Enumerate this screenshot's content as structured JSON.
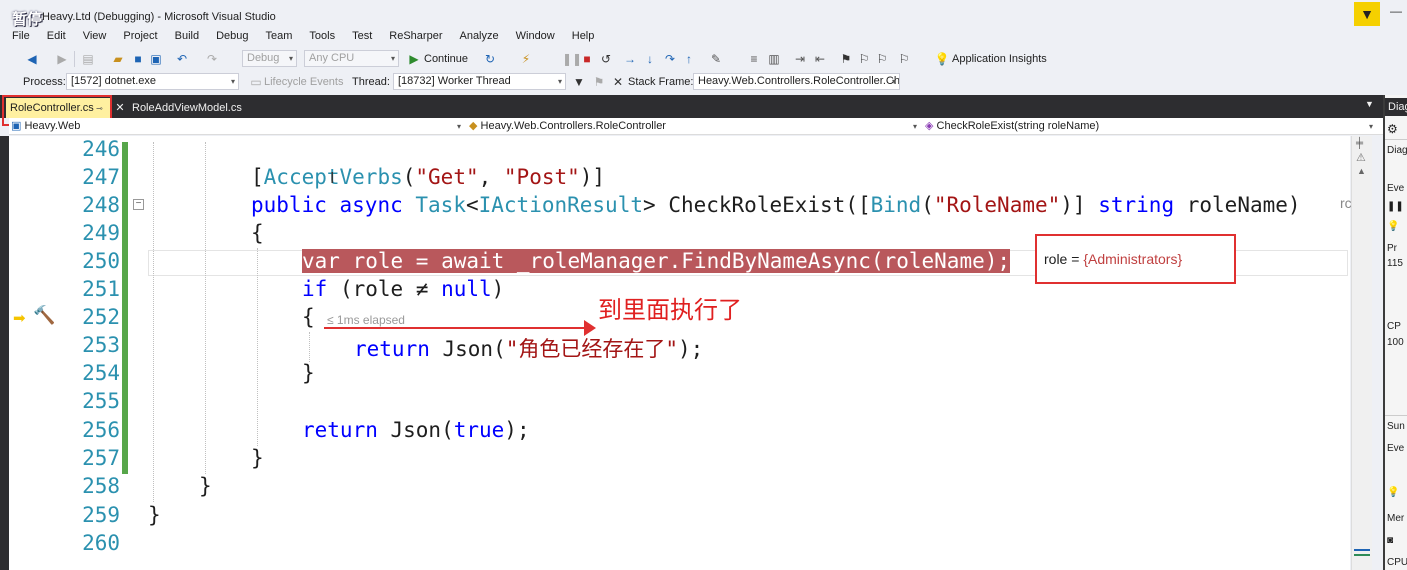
{
  "window": {
    "title": "Heavy.Ltd (Debugging) - Microsoft Visual Studio",
    "pause_badge": "暂停"
  },
  "menu": [
    "File",
    "Edit",
    "View",
    "Project",
    "Build",
    "Debug",
    "Team",
    "Tools",
    "Test",
    "ReSharper",
    "Analyze",
    "Window",
    "Help"
  ],
  "toolbar": {
    "config": "Debug",
    "platform": "Any CPU",
    "continue_label": "Continue",
    "app_insights_label": "Application Insights",
    "process_label": "Process:",
    "process_value": "[1572] dotnet.exe",
    "lifecycle_label": "Lifecycle Events",
    "thread_label": "Thread:",
    "thread_value": "[18732] Worker Thread",
    "stack_frame_label": "Stack Frame:",
    "stack_frame_value": "Heavy.Web.Controllers.RoleController.Che"
  },
  "tabs": {
    "active": "RoleController.cs",
    "inactive": "RoleAddViewModel.cs"
  },
  "navbar": {
    "project": "Heavy.Web",
    "class": "Heavy.Web.Controllers.RoleController",
    "member": "CheckRoleExist(string roleName)"
  },
  "editor": {
    "line_numbers": [
      "246",
      "247",
      "248",
      "249",
      "250",
      "251",
      "252",
      "253",
      "254",
      "255",
      "256",
      "257",
      "258",
      "259",
      "260"
    ],
    "elapsed": "≤ 1ms elapsed",
    "annotation": "到里面执行了",
    "datatip_name": "role = ",
    "datatip_value": "{Administrators}",
    "code": {
      "l247_a": "[",
      "l247_attr": "AcceptVerbs",
      "l247_b": "(",
      "l247_s1": "\"Get\"",
      "l247_c": ", ",
      "l247_s2": "\"Post\"",
      "l247_d": ")]",
      "l248_kw1": "public",
      "l248_kw2": "async",
      "l248_t1": "Task",
      "l248_lt": "<",
      "l248_t2": "IActionResult",
      "l248_gt": ">",
      "l248_name": "CheckRoleExist([",
      "l248_t3": "Bind",
      "l248_p": "(",
      "l248_s": "\"RoleName\"",
      "l248_q": ")]",
      "l248_kw3": "string",
      "l248_param": "roleName)",
      "l249": "{",
      "l250": "var role = await _roleManager.FindByNameAsync(roleName);",
      "l251_kw": "if",
      "l251_mid": " (role ≠ ",
      "l251_null": "null",
      "l251_end": ")",
      "l252": "{",
      "l253_kw": "return",
      "l253_mid": " Json(",
      "l253_s": "\"角色已经存在了\"",
      "l253_end": ");",
      "l254": "}",
      "l256_kw": "return",
      "l256_mid": " Json(",
      "l256_true": "true",
      "l256_end": ");",
      "l257": "}",
      "l258": "}",
      "l259": "}"
    },
    "right_overflow": "rc"
  },
  "right_panel": {
    "header": "Diag",
    "items": [
      "Diag",
      "Eve",
      "Pr",
      "115",
      "CP",
      "100",
      "Sun",
      "Eve",
      "Mer",
      "CPU"
    ]
  },
  "colors": {
    "highlight": "#b9585c",
    "annotation_red": "#e02020",
    "keyword": "#0000ff",
    "type": "#2b91af",
    "string": "#a31515"
  }
}
